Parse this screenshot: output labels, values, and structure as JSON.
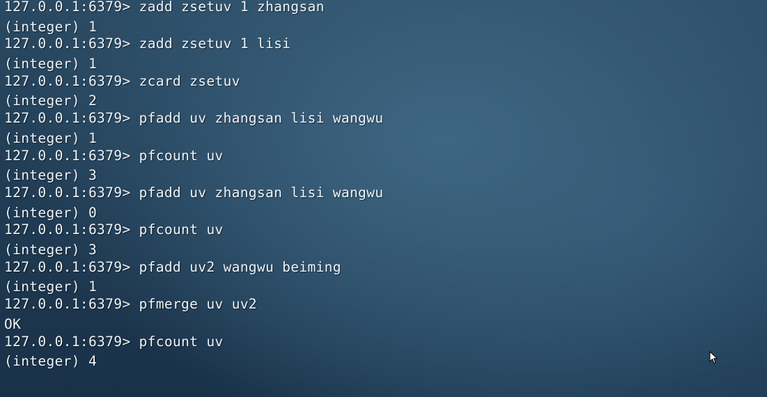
{
  "terminal": {
    "entries": [
      {
        "prompt": "127.0.0.1:6379> ",
        "command": "zadd zsetuv 1 zhangsan",
        "output": "(integer) 1"
      },
      {
        "prompt": "127.0.0.1:6379> ",
        "command": "zadd zsetuv 1 lisi",
        "output": "(integer) 1"
      },
      {
        "prompt": "127.0.0.1:6379> ",
        "command": "zcard zsetuv",
        "output": "(integer) 2"
      },
      {
        "prompt": "127.0.0.1:6379> ",
        "command": "pfadd uv zhangsan lisi wangwu",
        "output": "(integer) 1"
      },
      {
        "prompt": "127.0.0.1:6379> ",
        "command": "pfcount uv",
        "output": "(integer) 3"
      },
      {
        "prompt": "127.0.0.1:6379> ",
        "command": "pfadd uv zhangsan lisi wangwu",
        "output": "(integer) 0"
      },
      {
        "prompt": "127.0.0.1:6379> ",
        "command": "pfcount uv",
        "output": "(integer) 3"
      },
      {
        "prompt": "127.0.0.1:6379> ",
        "command": "pfadd uv2 wangwu beiming",
        "output": "(integer) 1"
      },
      {
        "prompt": "127.0.0.1:6379> ",
        "command": "pfmerge uv uv2",
        "output": "OK"
      },
      {
        "prompt": "127.0.0.1:6379> ",
        "command": "pfcount uv",
        "output": "(integer) 4"
      }
    ]
  },
  "cursor": {
    "icon": "mouse-pointer-icon"
  }
}
